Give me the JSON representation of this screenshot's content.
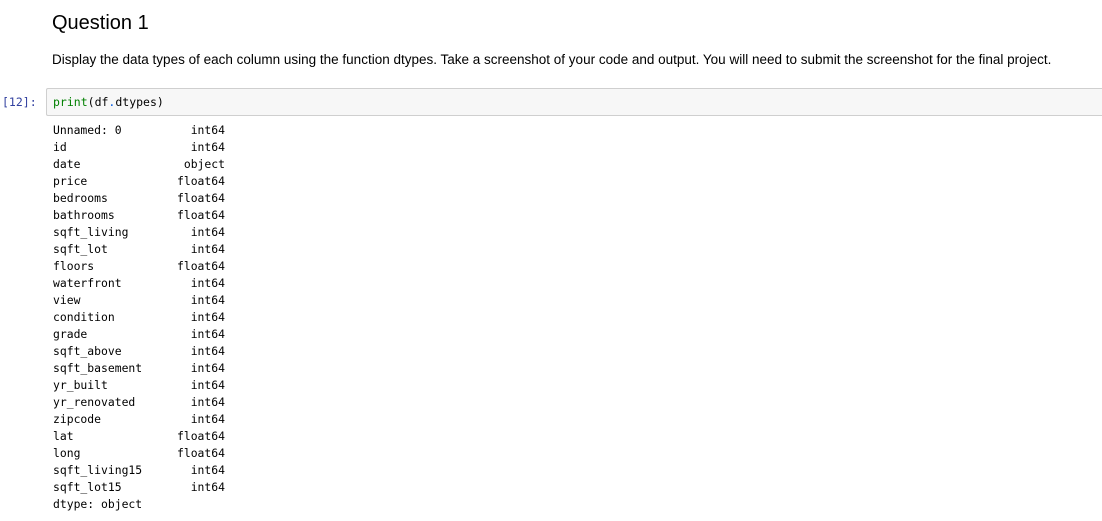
{
  "markdown": {
    "heading": "Question 1",
    "description": "Display the data types of each column using the function dtypes. Take a screenshot of your code and output. You will need to submit the screenshot for the final project."
  },
  "code_cell": {
    "prompt": "[12]:",
    "code": {
      "func": "print",
      "open": "(",
      "obj": "df",
      "dot": ".",
      "attr": "dtypes",
      "close": ")"
    }
  },
  "output": {
    "rows": [
      {
        "column": "Unnamed: 0",
        "dtype": "int64"
      },
      {
        "column": "id",
        "dtype": "int64"
      },
      {
        "column": "date",
        "dtype": "object"
      },
      {
        "column": "price",
        "dtype": "float64"
      },
      {
        "column": "bedrooms",
        "dtype": "float64"
      },
      {
        "column": "bathrooms",
        "dtype": "float64"
      },
      {
        "column": "sqft_living",
        "dtype": "int64"
      },
      {
        "column": "sqft_lot",
        "dtype": "int64"
      },
      {
        "column": "floors",
        "dtype": "float64"
      },
      {
        "column": "waterfront",
        "dtype": "int64"
      },
      {
        "column": "view",
        "dtype": "int64"
      },
      {
        "column": "condition",
        "dtype": "int64"
      },
      {
        "column": "grade",
        "dtype": "int64"
      },
      {
        "column": "sqft_above",
        "dtype": "int64"
      },
      {
        "column": "sqft_basement",
        "dtype": "int64"
      },
      {
        "column": "yr_built",
        "dtype": "int64"
      },
      {
        "column": "yr_renovated",
        "dtype": "int64"
      },
      {
        "column": "zipcode",
        "dtype": "int64"
      },
      {
        "column": "lat",
        "dtype": "float64"
      },
      {
        "column": "long",
        "dtype": "float64"
      },
      {
        "column": "sqft_living15",
        "dtype": "int64"
      },
      {
        "column": "sqft_lot15",
        "dtype": "int64"
      }
    ],
    "footer": "dtype: object"
  },
  "colors": {
    "prompt": "#303f9f",
    "builtin": "#008000",
    "operator": "#055be0",
    "input_bg": "#f7f7f7",
    "input_border": "#cfcfcf"
  }
}
